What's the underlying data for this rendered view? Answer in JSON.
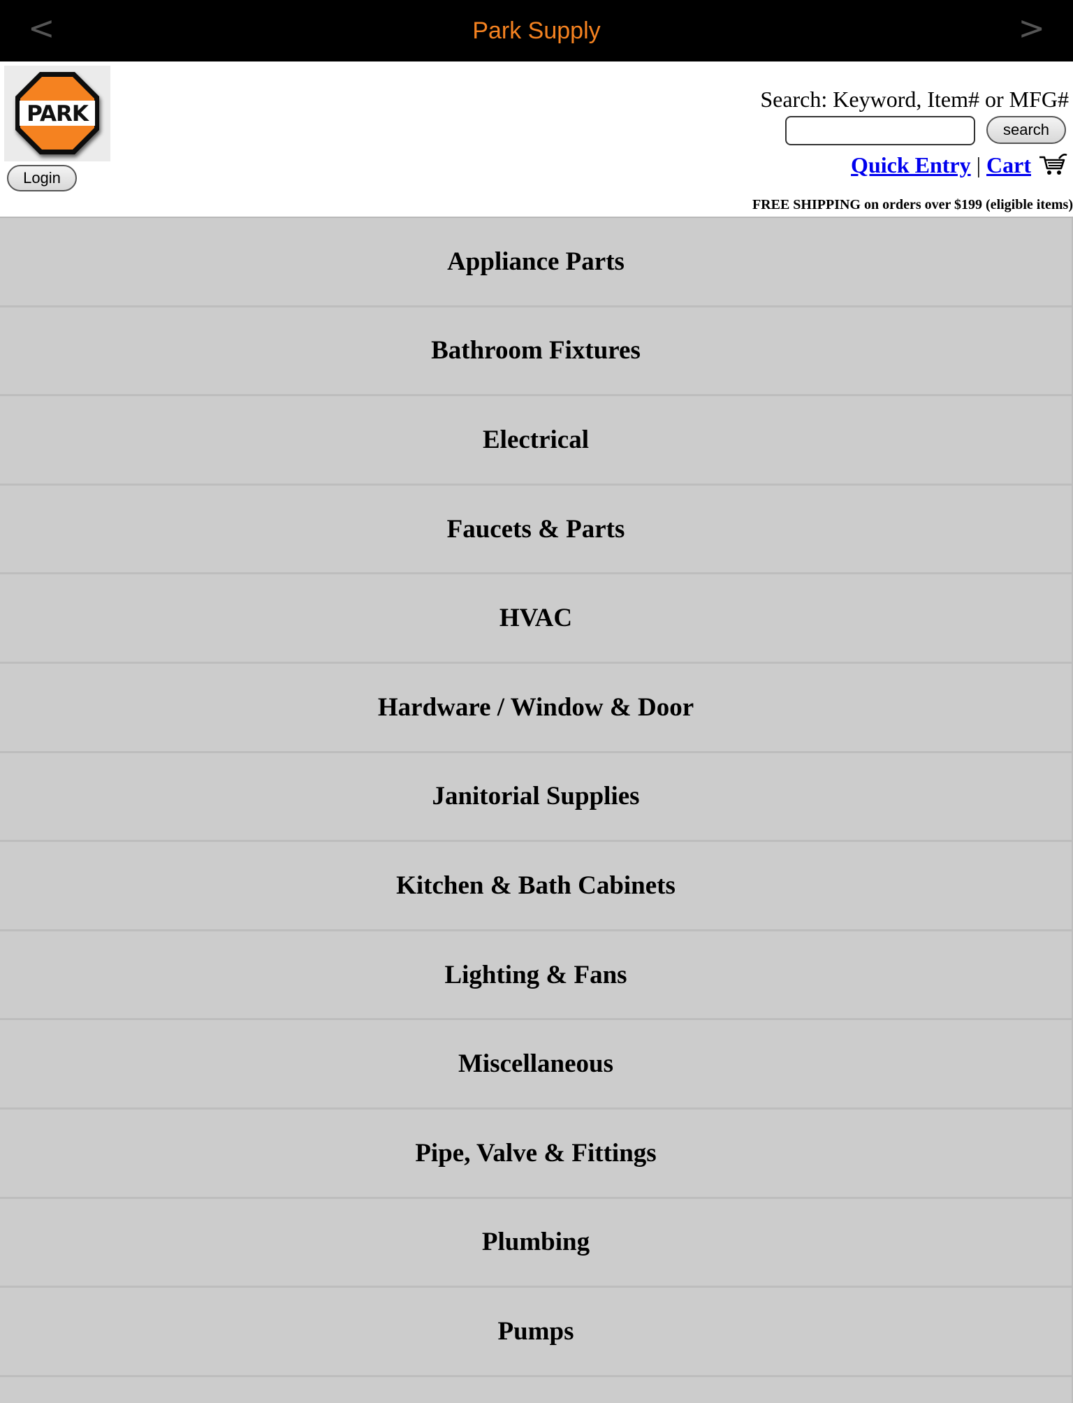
{
  "topbar": {
    "title": "Park Supply",
    "back_arrow": "<",
    "forward_arrow": ">",
    "title_color": "#f58220",
    "background": "#000000"
  },
  "header": {
    "logo_text": "PARK",
    "login_label": "Login",
    "search_label": "Search: Keyword, Item# or MFG#",
    "search_value": "",
    "search_button_label": "search",
    "quick_entry_label": "Quick Entry",
    "separator": "|",
    "cart_label": "Cart",
    "cart_icon": "shopping-cart-icon",
    "shipping_note": "FREE SHIPPING on orders over $199 (eligible items)",
    "link_color": "#0000ee"
  },
  "categories": [
    {
      "label": "Appliance Parts"
    },
    {
      "label": "Bathroom Fixtures"
    },
    {
      "label": "Electrical"
    },
    {
      "label": "Faucets & Parts"
    },
    {
      "label": "HVAC"
    },
    {
      "label": "Hardware / Window & Door"
    },
    {
      "label": "Janitorial Supplies"
    },
    {
      "label": "Kitchen & Bath Cabinets"
    },
    {
      "label": "Lighting & Fans"
    },
    {
      "label": "Miscellaneous"
    },
    {
      "label": "Pipe, Valve & Fittings"
    },
    {
      "label": "Plumbing"
    },
    {
      "label": "Pumps"
    },
    {
      "label": ""
    }
  ],
  "category_background": "#cccccc"
}
